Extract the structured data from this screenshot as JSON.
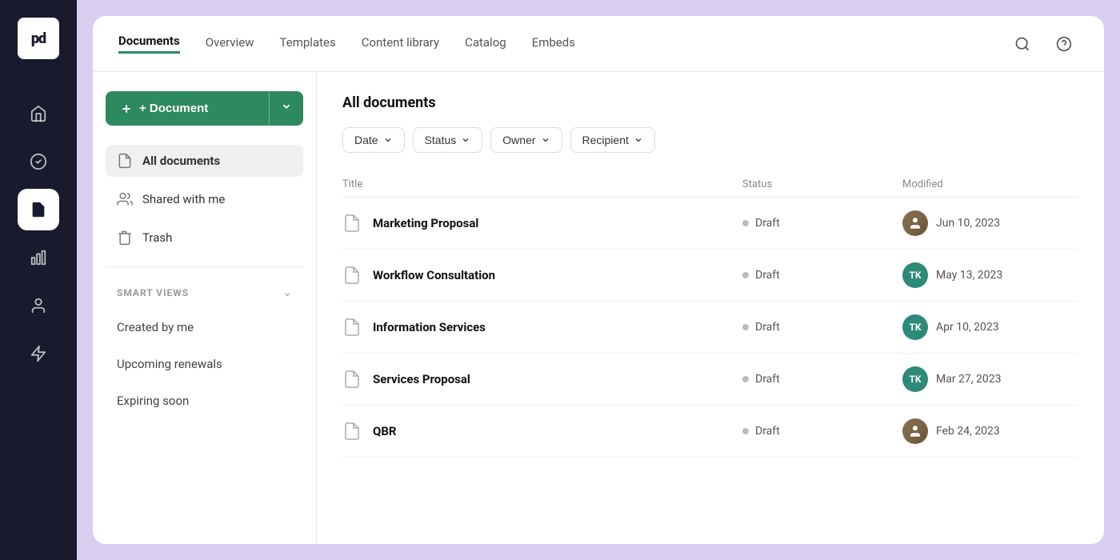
{
  "app": {
    "logo": "pd",
    "background_color": "#d8cef0"
  },
  "left_nav": {
    "icons": [
      {
        "name": "home-icon",
        "label": "Home",
        "active": false
      },
      {
        "name": "check-icon",
        "label": "Tasks",
        "active": false
      },
      {
        "name": "document-icon",
        "label": "Documents",
        "active": true
      },
      {
        "name": "chart-icon",
        "label": "Analytics",
        "active": false
      },
      {
        "name": "person-icon",
        "label": "Contacts",
        "active": false
      },
      {
        "name": "lightning-icon",
        "label": "Automations",
        "active": false
      }
    ]
  },
  "top_nav": {
    "tabs": [
      {
        "label": "Documents",
        "active": true
      },
      {
        "label": "Overview",
        "active": false
      },
      {
        "label": "Templates",
        "active": false
      },
      {
        "label": "Content library",
        "active": false
      },
      {
        "label": "Catalog",
        "active": false
      },
      {
        "label": "Embeds",
        "active": false
      }
    ],
    "search_label": "Search",
    "help_label": "Help"
  },
  "sidebar": {
    "new_document_btn": "+ Document",
    "nav_items": [
      {
        "label": "All documents",
        "active": true,
        "icon": "document-icon"
      },
      {
        "label": "Shared with me",
        "active": false,
        "icon": "shared-icon"
      },
      {
        "label": "Trash",
        "active": false,
        "icon": "trash-icon"
      }
    ],
    "smart_views_label": "SMART VIEWS",
    "smart_view_items": [
      {
        "label": "Created by me"
      },
      {
        "label": "Upcoming renewals"
      },
      {
        "label": "Expiring soon"
      }
    ]
  },
  "main": {
    "section_title": "All documents",
    "filters": [
      {
        "label": "Date"
      },
      {
        "label": "Status"
      },
      {
        "label": "Owner"
      },
      {
        "label": "Recipient"
      }
    ],
    "table_headers": {
      "title": "Title",
      "status": "Status",
      "modified": "Modified"
    },
    "documents": [
      {
        "title": "Marketing Proposal",
        "status": "Draft",
        "modified": "Jun 10, 2023",
        "avatar_type": "photo",
        "avatar_initials": ""
      },
      {
        "title": "Workflow Consultation",
        "status": "Draft",
        "modified": "May 13, 2023",
        "avatar_type": "teal",
        "avatar_initials": "TK"
      },
      {
        "title": "Information Services",
        "status": "Draft",
        "modified": "Apr 10, 2023",
        "avatar_type": "teal",
        "avatar_initials": "TK"
      },
      {
        "title": "Services Proposal",
        "status": "Draft",
        "modified": "Mar 27, 2023",
        "avatar_type": "teal",
        "avatar_initials": "TK"
      },
      {
        "title": "QBR",
        "status": "Draft",
        "modified": "Feb 24, 2023",
        "avatar_type": "photo",
        "avatar_initials": ""
      }
    ]
  }
}
